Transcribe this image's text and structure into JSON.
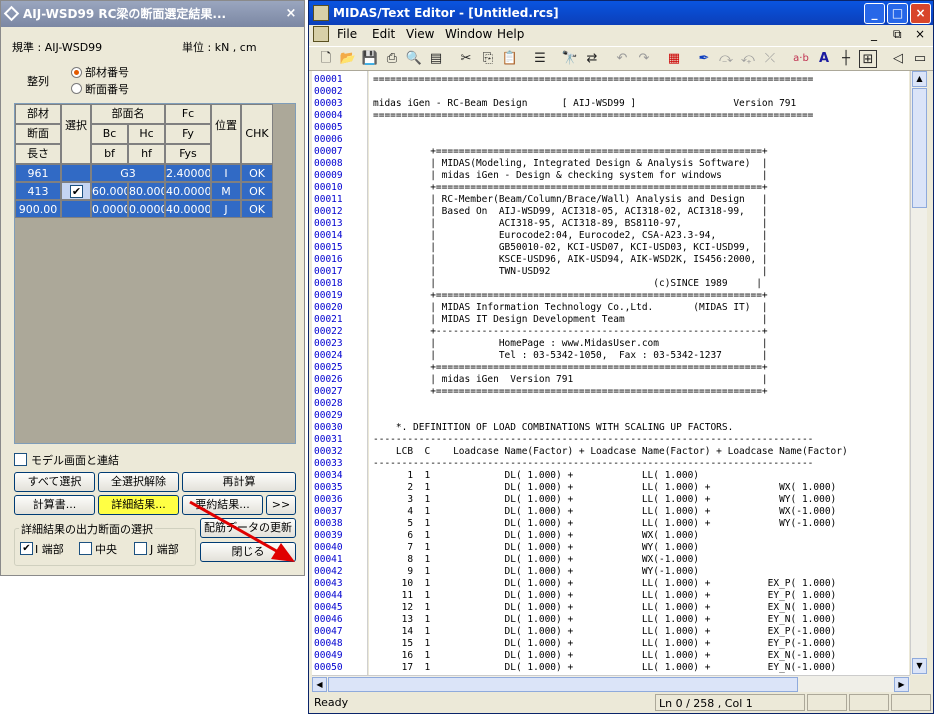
{
  "dialog": {
    "title": "AIJ-WSD99 RC梁の断面選定結果...",
    "close_glyph": "×",
    "code_label": "規準 : AIJ-WSD99",
    "unit_label": "単位 : kN , cm",
    "sort_label": "整列",
    "sort_options": [
      "部材番号",
      "断面番号"
    ],
    "table": {
      "h1": [
        "部材",
        "部面名",
        "Fc",
        "位置",
        "CHK"
      ],
      "h2": [
        "断面",
        "Bc",
        "Hc",
        "Fy"
      ],
      "h3": [
        "長さ",
        "bf",
        "hf",
        "Fys"
      ],
      "select_header": "選択",
      "rows": [
        {
          "member": "961",
          "name": "G3",
          "c1": "",
          "c2": "2.40000",
          "pos": "I",
          "chk": "OK"
        },
        {
          "member": "413",
          "name": "",
          "c1": "60.000",
          "c2": "80.000",
          "c3": "40.0000",
          "pos": "M",
          "chk": "OK"
        },
        {
          "member": "900.00",
          "name": "",
          "c1": "0.0000",
          "c2": "0.0000",
          "c3": "40.0000",
          "pos": "J",
          "chk": "OK"
        }
      ]
    },
    "link_label": "モデル画面と連結",
    "buttons": {
      "select_all": "すべて選択",
      "deselect_all": "全選択解除",
      "recalc": "再計算",
      "calc_report": "計算書...",
      "detail_result": "詳細結果...",
      "summary_result": "要約結果...",
      "more": ">>",
      "update_rebar": "配筋データの更新",
      "close": "閉じる"
    },
    "output_group_label": "詳細結果の出力断面の選択",
    "output_options": [
      "I 端部",
      "中央",
      "J 端部"
    ]
  },
  "editor": {
    "title": "MIDAS/Text Editor - [Untitled.rcs]",
    "menu": [
      "File",
      "Edit",
      "View",
      "Window",
      "Help"
    ],
    "line_numbers": [
      "00001",
      "00002",
      "00003",
      "00004",
      "00005",
      "00006",
      "00007",
      "00008",
      "00009",
      "00010",
      "00011",
      "00012",
      "00013",
      "00014",
      "00015",
      "00016",
      "00017",
      "00018",
      "00019",
      "00020",
      "00021",
      "00022",
      "00023",
      "00024",
      "00025",
      "00026",
      "00027",
      "00028",
      "00029",
      "00030",
      "00031",
      "00032",
      "00033",
      "00034",
      "00035",
      "00036",
      "00037",
      "00038",
      "00039",
      "00040",
      "00041",
      "00042",
      "00043",
      "00044",
      "00045",
      "00046",
      "00047",
      "00048",
      "00049",
      "00050"
    ],
    "lines": [
      "=============================================================================",
      "",
      "midas iGen - RC-Beam Design      [ AIJ-WSD99 ]                 Version 791",
      "=============================================================================",
      "",
      "",
      "          +=========================================================+",
      "          | MIDAS(Modeling, Integrated Design & Analysis Software)  |",
      "          | midas iGen - Design & checking system for windows       |",
      "          +=========================================================+",
      "          | RC-Member(Beam/Column/Brace/Wall) Analysis and Design   |",
      "          | Based On  AIJ-WSD99, ACI318-05, ACI318-02, ACI318-99,   |",
      "          |           ACI318-95, ACI318-89, BS8110-97,              |",
      "          |           Eurocode2:04, Eurocode2, CSA-A23.3-94,        |",
      "          |           GB50010-02, KCI-USD07, KCI-USD03, KCI-USD99,  |",
      "          |           KSCE-USD96, AIK-USD94, AIK-WSD2K, IS456:2000, |",
      "          |           TWN-USD92                                     |",
      "          |                                      (c)SINCE 1989     |",
      "          +=========================================================+",
      "          | MIDAS Information Technology Co.,Ltd.       (MIDAS IT)  |",
      "          | MIDAS IT Design Development Team                        |",
      "          +---------------------------------------------------------+",
      "          |           HomePage : www.MidasUser.com                  |",
      "          |           Tel : 03-5342-1050,  Fax : 03-5342-1237       |",
      "          +=========================================================+",
      "          | midas iGen  Version 791                                 |",
      "          +=========================================================+",
      "",
      "",
      "    *. DEFINITION OF LOAD COMBINATIONS WITH SCALING UP FACTORS.",
      "-----------------------------------------------------------------------------",
      "    LCB  C    Loadcase Name(Factor) + Loadcase Name(Factor) + Loadcase Name(Factor)",
      "-----------------------------------------------------------------------------",
      "      1  1             DL( 1.000) +            LL( 1.000)",
      "      2  1             DL( 1.000) +            LL( 1.000) +            WX( 1.000)",
      "      3  1             DL( 1.000) +            LL( 1.000) +            WY( 1.000)",
      "      4  1             DL( 1.000) +            LL( 1.000) +            WX(-1.000)",
      "      5  1             DL( 1.000) +            LL( 1.000) +            WY(-1.000)",
      "      6  1             DL( 1.000) +            WX( 1.000)",
      "      7  1             DL( 1.000) +            WY( 1.000)",
      "      8  1             DL( 1.000) +            WX(-1.000)",
      "      9  1             DL( 1.000) +            WY(-1.000)",
      "     10  1             DL( 1.000) +            LL( 1.000) +          EX_P( 1.000)",
      "     11  1             DL( 1.000) +            LL( 1.000) +          EY_P( 1.000)",
      "     12  1             DL( 1.000) +            LL( 1.000) +          EX_N( 1.000)",
      "     13  1             DL( 1.000) +            LL( 1.000) +          EY_N( 1.000)",
      "     14  1             DL( 1.000) +            LL( 1.000) +          EX_P(-1.000)",
      "     15  1             DL( 1.000) +            LL( 1.000) +          EY_P(-1.000)",
      "     16  1             DL( 1.000) +            LL( 1.000) +          EX_N(-1.000)",
      "     17  1             DL( 1.000) +            LL( 1.000) +          EY_N(-1.000)"
    ],
    "status_ready": "Ready",
    "status_position": "Ln 0 / 258 , Col 1"
  },
  "colors": {
    "titlebar_active": "#0a54e0",
    "titlebar_inactive": "#8a97b4",
    "line_number": "#0000d0",
    "highlight_button": "#ffff44",
    "arrow": "#e00000"
  }
}
